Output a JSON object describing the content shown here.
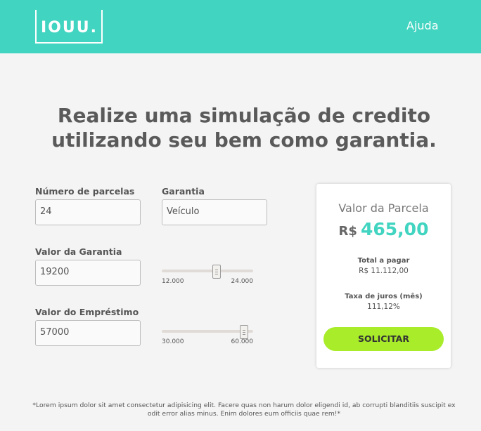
{
  "header": {
    "logo_text": "IOUU.",
    "help_link": "Ajuda",
    "bg_color": "#41d4c0"
  },
  "title": {
    "line1": "Realize uma simulação de credito",
    "line2": "utilizando seu bem como garantia."
  },
  "form": {
    "parcelas": {
      "label": "Número de parcelas",
      "value": "24"
    },
    "garantia": {
      "label": "Garantia",
      "value": "Veículo"
    },
    "valor_garantia": {
      "label": "Valor da Garantia",
      "value": "19200",
      "slider_min": "12.000",
      "slider_max": "24.000",
      "slider_level": 0.6
    },
    "valor_emprestimo": {
      "label": "Valor do Empréstimo",
      "value": "57000",
      "slider_min": "30.000",
      "slider_max": "60.000",
      "slider_level": 0.9
    }
  },
  "result": {
    "title": "Valor da Parcela",
    "currency": "R$",
    "installment": "465,00",
    "total_label": "Total a pagar",
    "total_value": "R$ 11.112,00",
    "rate_label": "Taxa de juros (mês)",
    "rate_value": "111,12%",
    "button": "SOLICITAR",
    "accent_color": "#41d4c0",
    "button_color": "#a8ec2a"
  },
  "footer": {
    "disclaimer": "*Lorem ipsum dolor sit amet consectetur adipisicing elit. Facere quas non harum dolor eligendi id, ab corrupti blanditiis suscipit ex odit error alias minus. Enim dolores eum officiis quae rem!*"
  }
}
